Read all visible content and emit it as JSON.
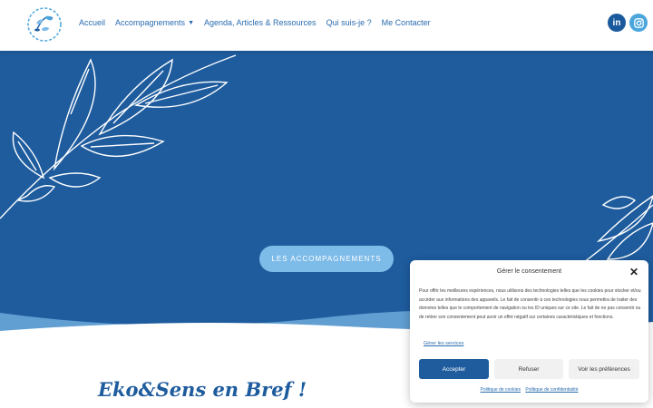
{
  "header": {
    "logo_alt": "Eko&Sens",
    "nav": [
      {
        "label": "Accueil"
      },
      {
        "label": "Accompagnements",
        "has_dropdown": true
      },
      {
        "label": "Agenda, Articles & Ressources"
      },
      {
        "label": "Qui suis-je ?"
      },
      {
        "label": "Me Contacter"
      }
    ],
    "social": {
      "linkedin": "in",
      "instagram": "instagram-icon"
    }
  },
  "hero": {
    "cta_label": "LES ACCOMPAGNEMENTS"
  },
  "section": {
    "title": "Eko&Sens en Bref !"
  },
  "consent": {
    "title": "Gérer le consentement",
    "text": "Pour offrir les meilleures expériences, nous utilisons des technologies telles que les cookies pour stocker et/ou accéder aux informations des appareils. Le fait de consentir à ces technologies nous permettra de traiter des données telles que le comportement de navigation ou les ID uniques sur ce site. Le fait de ne pas consentir ou de retirer son consentement peut avoir un effet négatif sur certaines caractéristiques et fonctions.",
    "services_link": "Gérer les services",
    "accept": "Accepter",
    "refuse": "Refuser",
    "preferences": "Voir les préférences",
    "cookie_policy": "Politique de cookies",
    "privacy_policy": "Politique de confidentialité"
  },
  "colors": {
    "brand_blue": "#1e5c9e",
    "light_blue": "#7dbbe8",
    "nav_text": "#2a6cb0"
  }
}
